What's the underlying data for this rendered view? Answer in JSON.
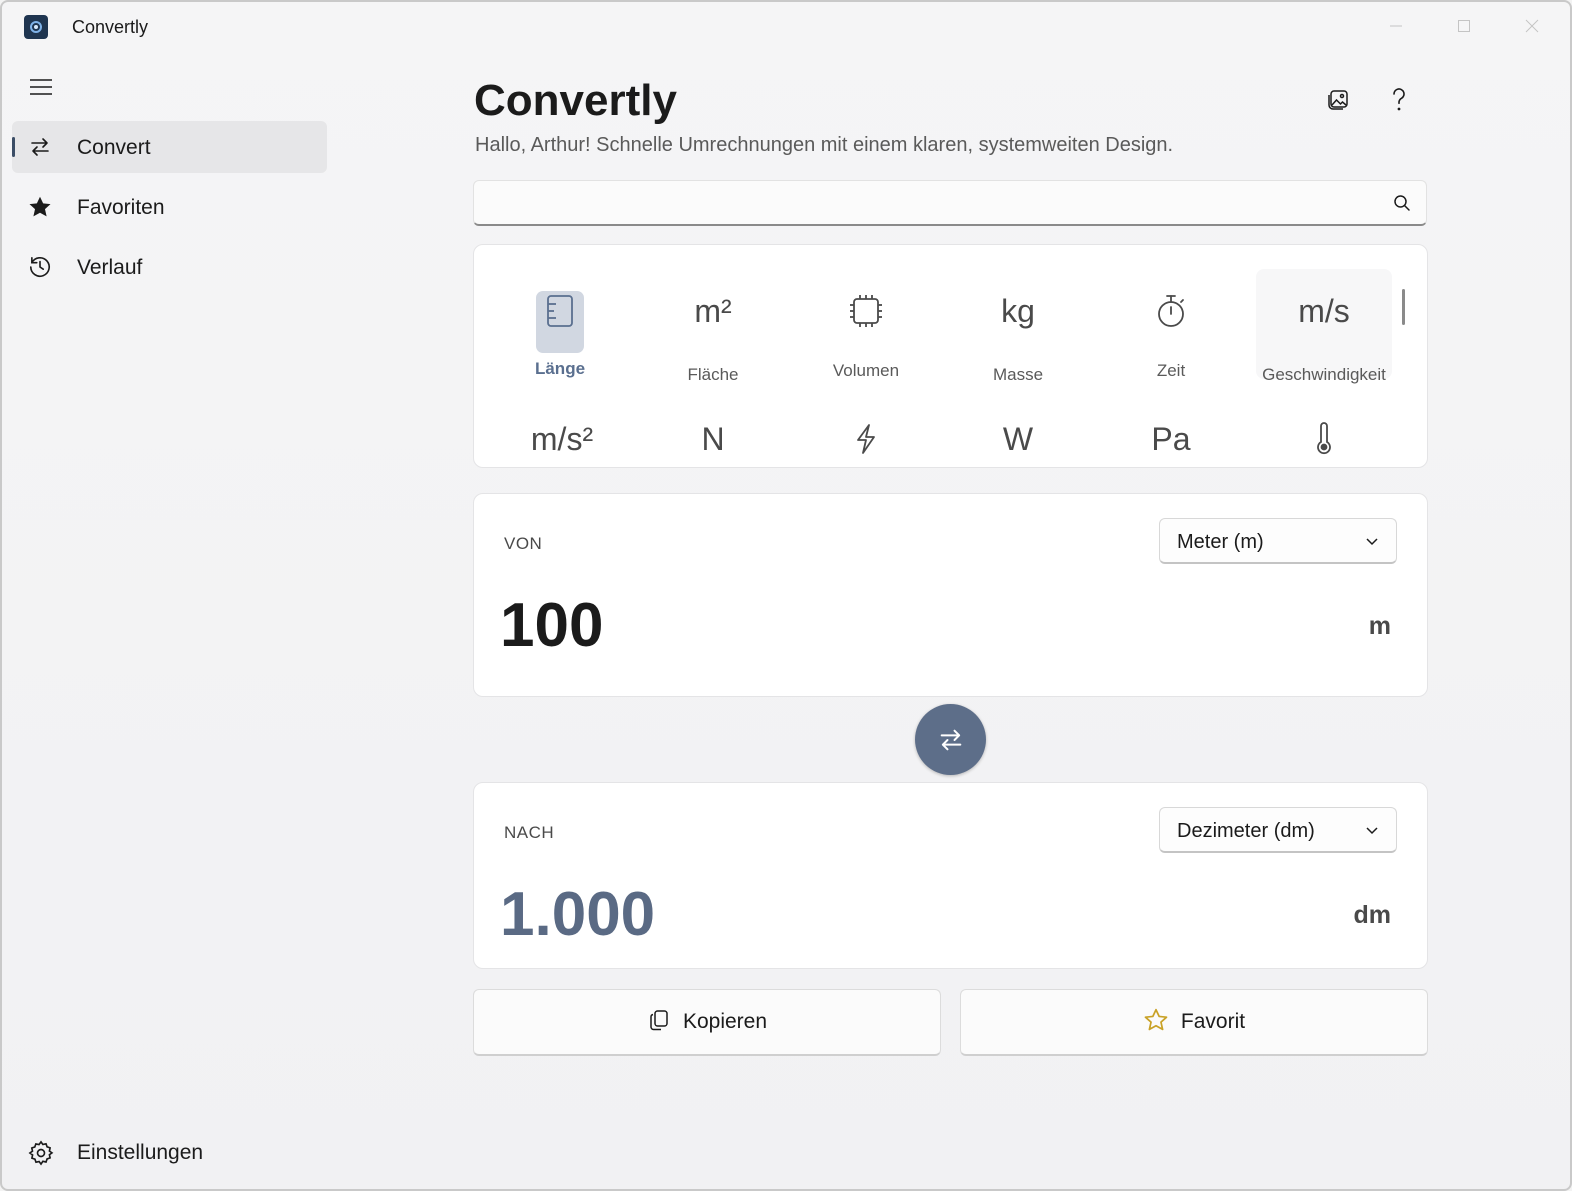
{
  "window": {
    "title": "Convertly"
  },
  "nav": {
    "items": [
      {
        "label": "Convert",
        "icon": "swap-arrows-icon",
        "active": true
      },
      {
        "label": "Favoriten",
        "icon": "star-filled-icon"
      },
      {
        "label": "Verlauf",
        "icon": "history-icon"
      }
    ],
    "settings_label": "Einstellungen"
  },
  "header": {
    "title": "Convertly",
    "subtitle": "Hallo, Arthur! Schnelle Umrechnungen mit einem klaren, systemweiten Design."
  },
  "search": {
    "placeholder": "",
    "value": ""
  },
  "categories": [
    {
      "symbol": "",
      "icon": "ruler-icon",
      "label": "Länge",
      "selected": true
    },
    {
      "symbol": "m²",
      "label": "Fläche"
    },
    {
      "symbol": "",
      "icon": "cube-icon",
      "label": "Volumen"
    },
    {
      "symbol": "kg",
      "label": "Masse"
    },
    {
      "symbol": "",
      "icon": "stopwatch-icon",
      "label": "Zeit"
    },
    {
      "symbol": "m/s",
      "label": "Geschwindigkeit"
    },
    {
      "symbol": "m/s²",
      "label": ""
    },
    {
      "symbol": "N",
      "label": ""
    },
    {
      "symbol": "",
      "icon": "lightning-icon",
      "label": ""
    },
    {
      "symbol": "W",
      "label": ""
    },
    {
      "symbol": "Pa",
      "label": ""
    },
    {
      "symbol": "",
      "icon": "thermometer-icon",
      "label": ""
    }
  ],
  "from": {
    "caption": "VON",
    "unit_select": "Meter (m)",
    "value": "100",
    "unit": "m"
  },
  "to": {
    "caption": "NACH",
    "unit_select": "Dezimeter (dm)",
    "value": "1.000",
    "unit": "dm"
  },
  "actions": {
    "copy_label": "Kopieren",
    "favorite_label": "Favorit"
  },
  "colors": {
    "accent": "#5d6e89",
    "result": "#5a6a84",
    "star": "#c9a227"
  }
}
